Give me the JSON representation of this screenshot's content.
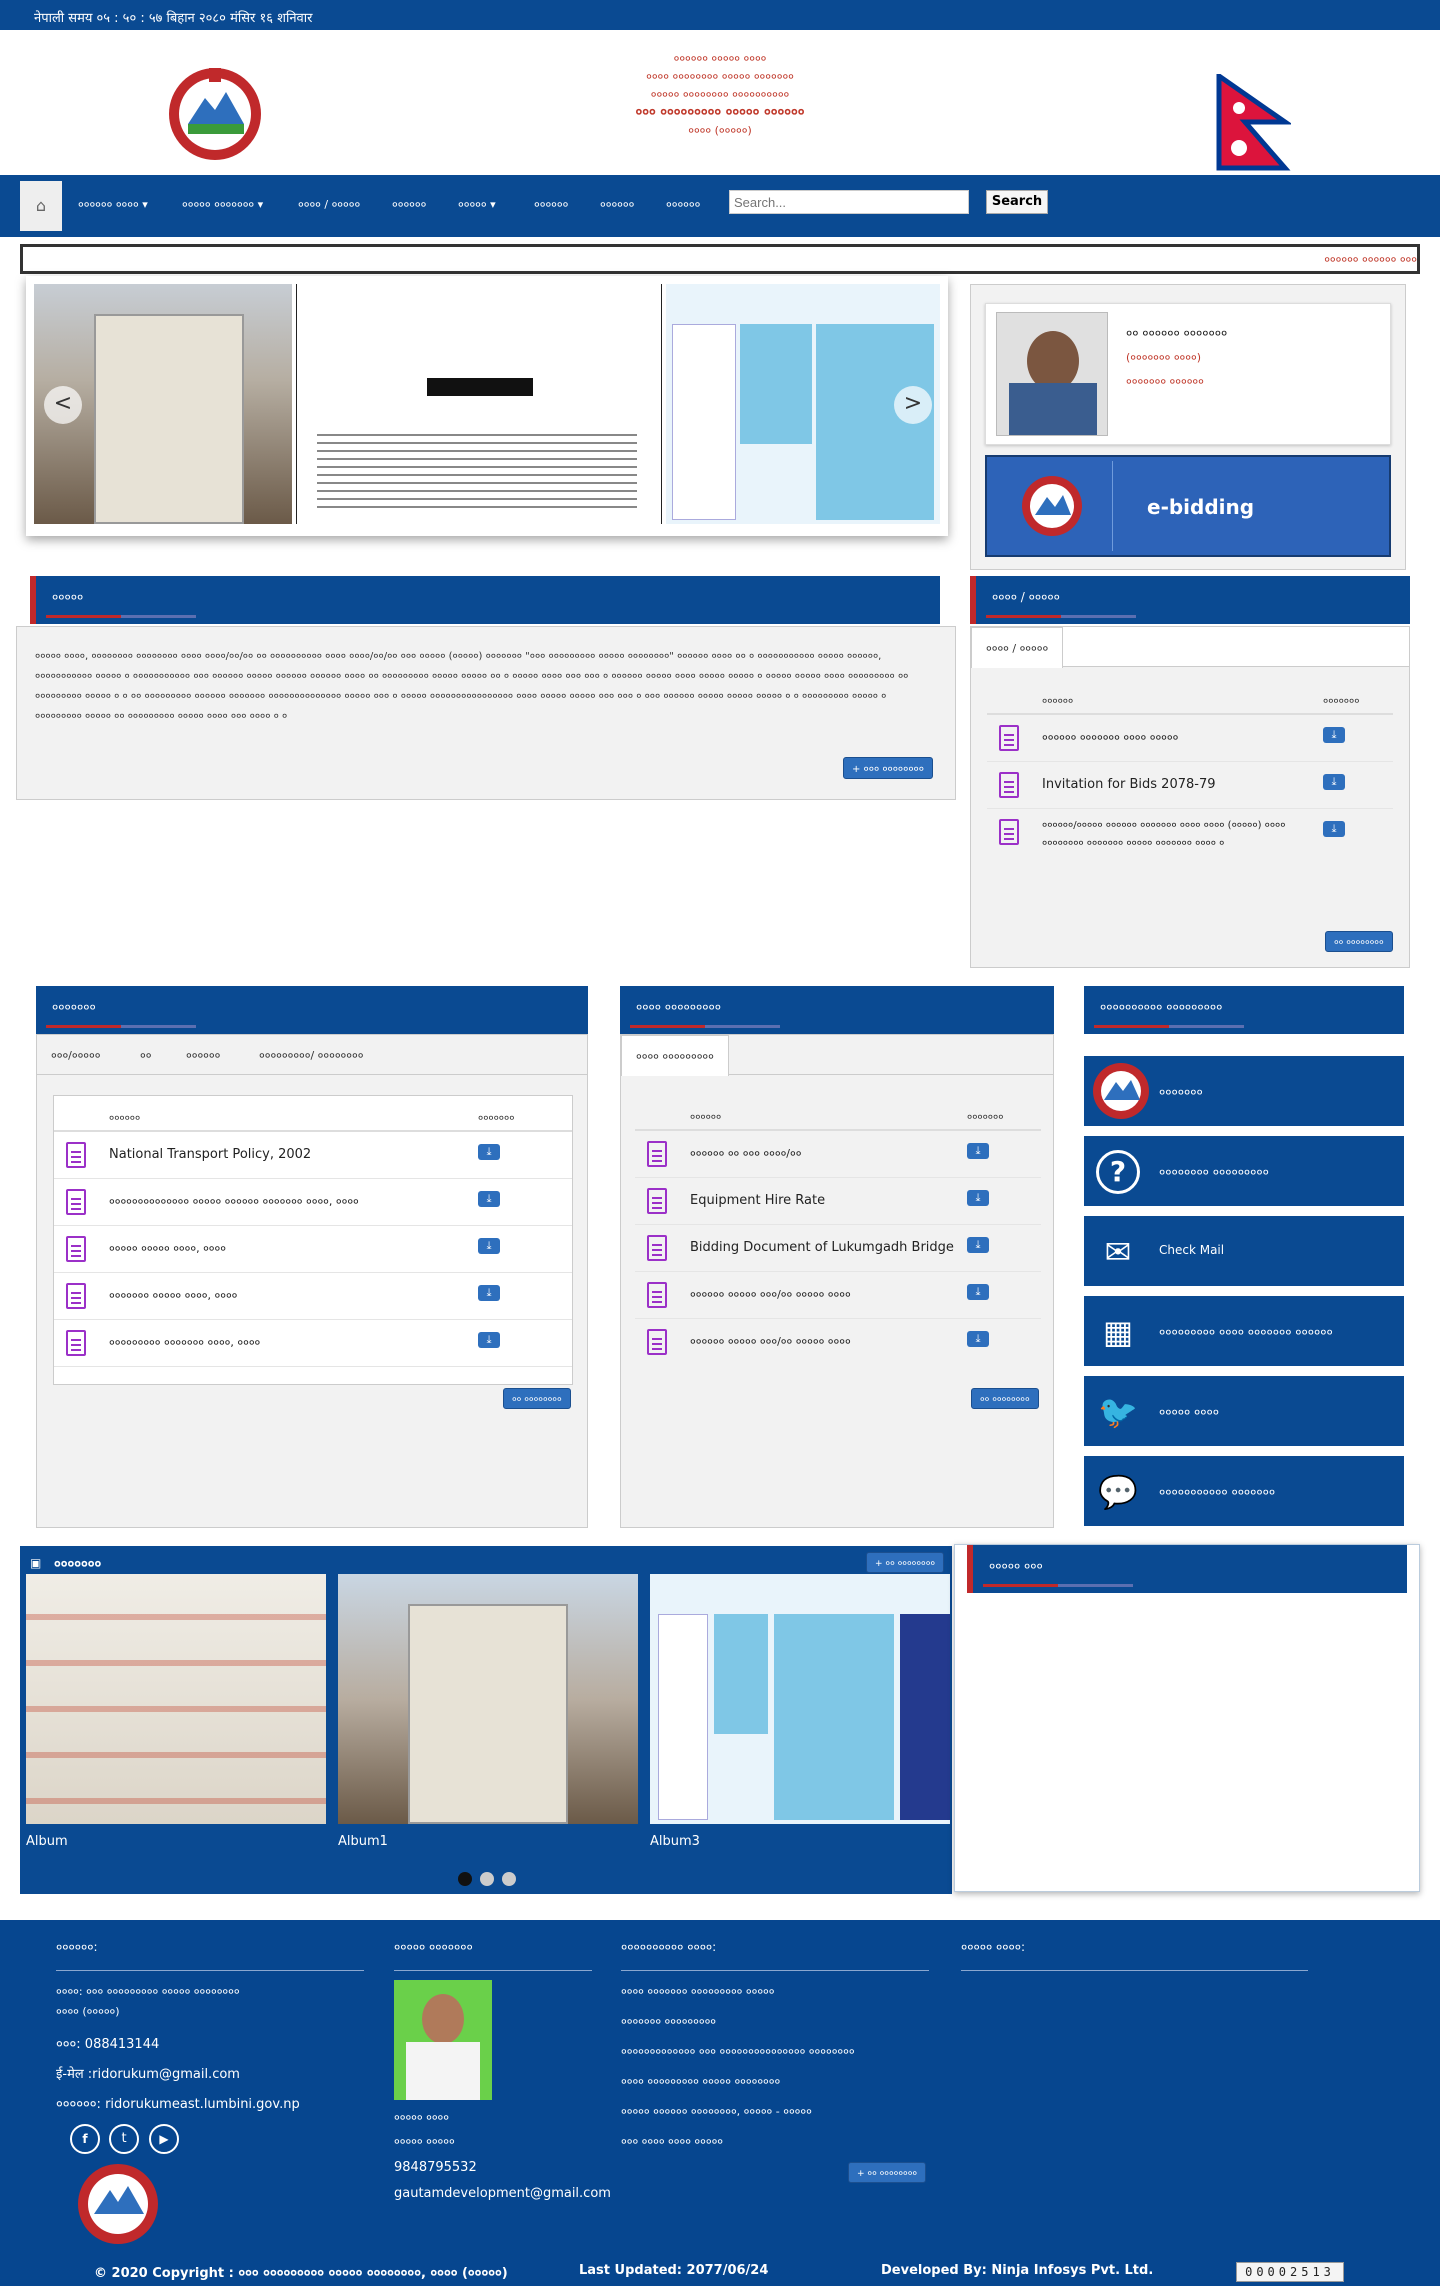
{
  "topbar": {
    "text": "नेपाली समय ०५ : ५० : ५७ बिहान  २०८० मंसिर १६ शनिवार"
  },
  "header": {
    "line1": "०००००० ००००० ००००",
    "line2": "०००० ०००००००० ००००० ०००००००",
    "line3": "००००० ०००००००० ००००००००००",
    "line4": "००० ००००००००० ००००० ००००००",
    "line5": "०००० (०००००)"
  },
  "nav": {
    "items": [
      "०००००० ००००",
      "००००० ०००००००",
      "०००० / ०००००",
      "००००००",
      "०००००",
      "००००००",
      "००००००",
      "००००००"
    ],
    "search_placeholder": "Search...",
    "search_label": "Search"
  },
  "ticker": {
    "text": "०००००० ०००००० ०००"
  },
  "slider": {
    "prev": "<",
    "next": ">"
  },
  "chief": {
    "name": "०० ०००००० ०००००००",
    "title": "(००००००० ००००)",
    "role": "००००००० ००००००"
  },
  "ebid": {
    "label": "e-bidding"
  },
  "intro": {
    "title": "०००००",
    "body": "००००० ००००, ०००००००० ०००००००० ०००० ००००/००/०० ०० ०००००००००० ०००० ००००/००/०० ००० ००००० (०००००) ००००००० \"००० ००००००००० ००००० ००००००००\" ०००००० ०००० ०० ० ००००००००००० ००००० ००००००, ००००००००००० ००००० ० ००००००००००० ००० ०००००० ००००० ०००००० ०००००० ०००० ०० ००००००००० ००००० ००००० ०० ० ००००० ०००० ००० ००० ० ०००००० ००००० ०००० ००००० ००००० ० ००००० ००००० ०००० ००००००००० ०० ००००००००० ००००० ० ० ०० ००००००००० ०००००० ००००००० ०००००००००००००० ००००० ००० ० ००००० ०००००००००००००००० ०००० ००००० ००००० ००० ००० ० ००० ०००००० ००००० ००००० ००००० ० ० ००००००००० ००००० ० ००००००००० ००००० ०० ००००००००० ००००० ०००० ००० ०००० ० ०",
    "more": "+ ००० ००००००००"
  },
  "notice": {
    "title": "०००० / ०००००",
    "tab": "०००० / ०००००",
    "col1": "००००००",
    "col2": "०००००००",
    "rows": [
      "०००००० ००००००० ०००० ०००००",
      "Invitation for Bids 2078-79",
      "००००००/००००० ०००००० ००००००० ०००० ०००० (०००००) ०००० ०००००००० ००००००० ००००० ००००००० ०००० ०"
    ],
    "more": "०० ००००००००"
  },
  "docs": {
    "title": "०००००००",
    "tabs": [
      "०००/०००००",
      "००",
      "००००००",
      "०००००००००/ ००००००००"
    ],
    "col1": "००००००",
    "col2": "०००००००",
    "rows": [
      "National Transport Policy, 2002",
      "०००००००००००००० ००००० ०००००० ००००००० ००००, ००००",
      "००००० ००००० ००००, ००००",
      "००००००० ००००० ००००, ००००",
      "००००००००० ००००००० ००००, ००००"
    ],
    "more": "०० ००००००००"
  },
  "procure": {
    "title": "०००० ०००००००००",
    "tab": "०००० ०००००००००",
    "col1": "००००००",
    "col2": "०००००००",
    "rows": [
      "०००००० ०० ००० ००००/००",
      "Equipment Hire Rate",
      "Bidding Document of Lukumgadh Bridge",
      "०००००० ००००० ०००/०० ००००० ००००",
      "०००००० ००००० ०००/०० ००००० ००००"
    ],
    "more": "०० ००००००००"
  },
  "services": {
    "title": "०००००००००० ०००००००००",
    "items": [
      "०००००००",
      "०००००००० ०००००००००",
      "Check Mail",
      "००००००००० ०००० ००००००० ००००००",
      "००००० ००००",
      "००००००००००० ०००००००"
    ]
  },
  "gallery": {
    "title": "०००००००",
    "more": "+ ०० ००००००००",
    "captions": [
      "Album",
      "Album1",
      "Album3"
    ]
  },
  "social": {
    "title": "००००० ०००"
  },
  "footer": {
    "h1": "००००००:",
    "h2": "००००० ०००००००",
    "h3": "०००००००००० ००००:",
    "h4": "००००० ००००:",
    "addr1": "००००: ००० ००००००००० ००००० ००००००००",
    "addr2": "०००० (०००००)",
    "phone": "०००: 088413144",
    "email": "ई-मेल :ridorukum@gmail.com",
    "web": "००००००: ridorukumeast.lumbini.gov.np",
    "person_name": "००००० ००००",
    "person_role": "००००० ०००००",
    "person_phone": "9848795532",
    "person_email": "gautamdevelopment@gmail.com",
    "links": [
      "०००० ००००००० ००००००००० ०००००",
      "००००००० ०००००००००",
      "००००००००००००० ००० ००००००००००००००० ००००००००",
      "०००० ००००००००० ००००० ००००००००",
      "००००० ०००००० ००००००००, ००००० - ०००००",
      "००० ०००० ०००० ०००००"
    ],
    "links_more": "+ ०० ००००००००",
    "copyright": "© 2020 Copyright : ००० ००००००००० ००००० ००००००००, ०००० (०००००)",
    "updated": "Last Updated: 2077/06/24",
    "developer": "Developed By: Ninja Infosys Pvt. Ltd.",
    "counter": "00002513"
  }
}
